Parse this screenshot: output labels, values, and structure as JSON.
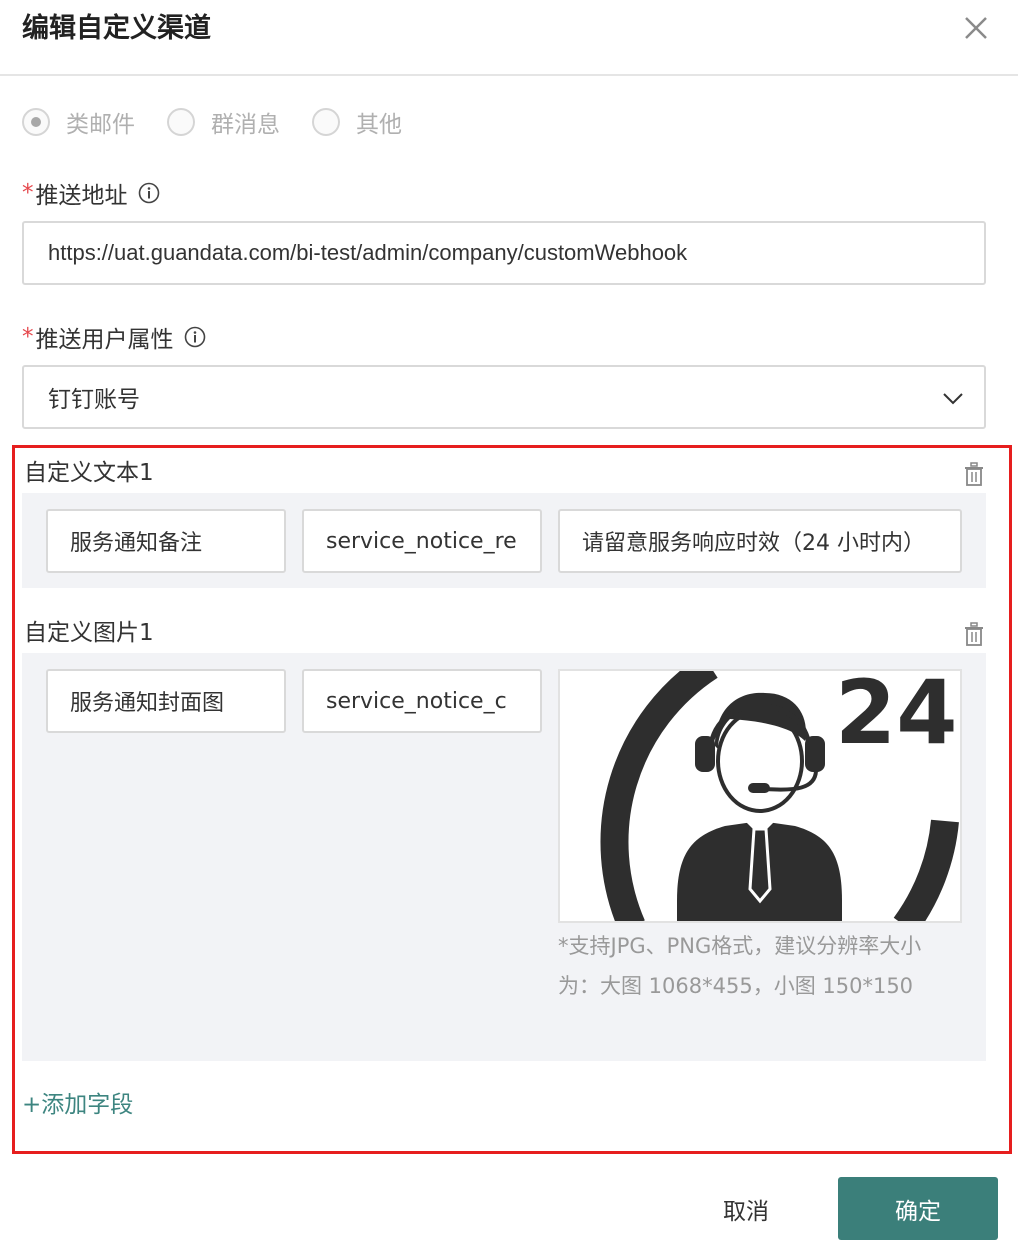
{
  "dialog": {
    "title": "编辑自定义渠道"
  },
  "channel_type": {
    "options": [
      {
        "label": "类邮件",
        "checked": true
      },
      {
        "label": "群消息",
        "checked": false
      },
      {
        "label": "其他",
        "checked": false
      }
    ]
  },
  "push_url": {
    "required_mark": "*",
    "label": "推送地址",
    "value": "https://uat.guandata.com/bi-test/admin/company/customWebhook"
  },
  "push_user_attr": {
    "required_mark": "*",
    "label": "推送用户属性",
    "value": "钉钉账号"
  },
  "custom_text": {
    "title": "自定义文本1",
    "name": "服务通知备注",
    "key": "service_notice_re",
    "value": "请留意服务响应时效（24 小时内）"
  },
  "custom_image": {
    "title": "自定义图片1",
    "name": "服务通知封面图",
    "key": "service_notice_c",
    "image_text": "24",
    "hint": "*支持JPG、PNG格式，建议分辨率大小为：大图 1068*455，小图 150*150"
  },
  "add_field": "+添加字段",
  "footer": {
    "cancel": "取消",
    "confirm": "确定"
  },
  "colors": {
    "accent": "#3b7f7a",
    "highlight_frame": "#e61e1e",
    "required": "#e5484d"
  }
}
